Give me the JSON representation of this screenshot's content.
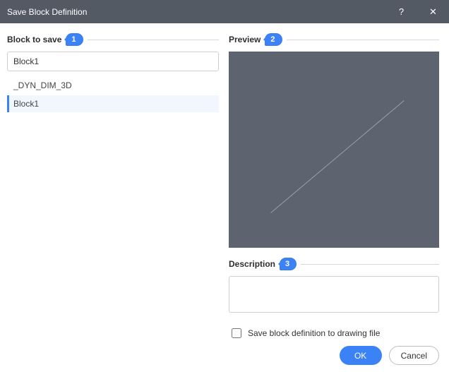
{
  "title": "Save Block Definition",
  "sections": {
    "block_to_save": {
      "label": "Block to save",
      "callout": "1"
    },
    "preview": {
      "label": "Preview",
      "callout": "2"
    },
    "description": {
      "label": "Description",
      "callout": "3"
    }
  },
  "name_input": {
    "value": "Block1",
    "placeholder": ""
  },
  "blocks": [
    {
      "label": "_DYN_DIM_3D",
      "selected": false
    },
    {
      "label": "Block1",
      "selected": true
    }
  ],
  "description_text": "",
  "save_to_file": {
    "checked": false,
    "label": "Save block definition to drawing file"
  },
  "buttons": {
    "ok": "OK",
    "cancel": "Cancel"
  },
  "titlebar": {
    "help": "?",
    "close": "✕"
  }
}
